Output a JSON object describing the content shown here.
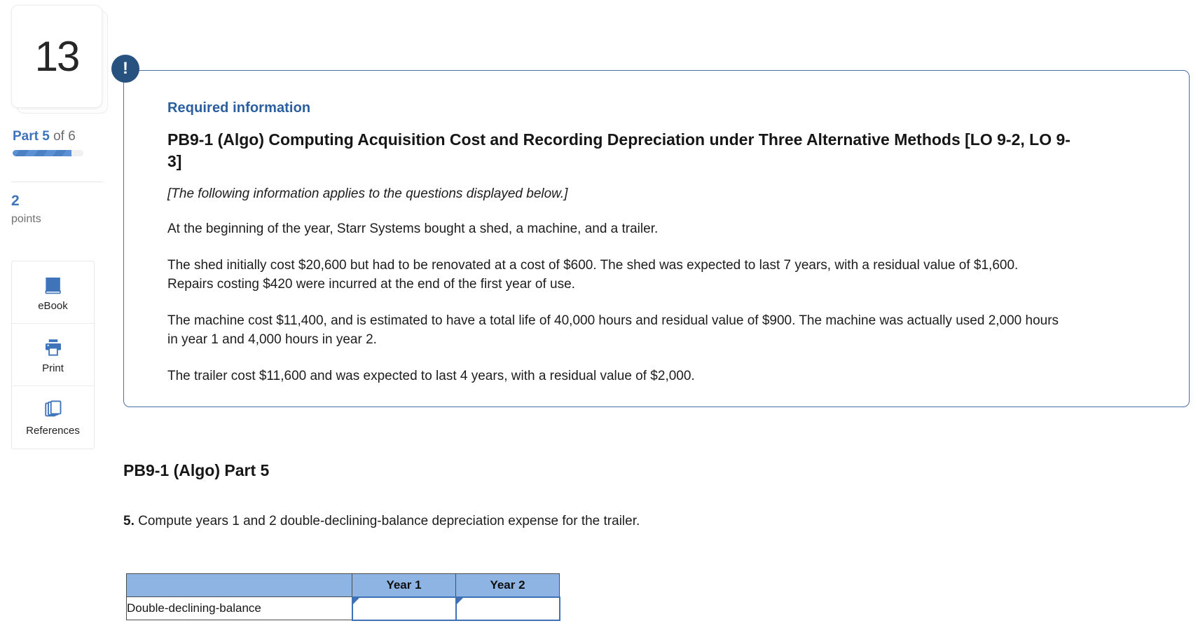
{
  "sidebar": {
    "question_number": "13",
    "part_prefix": "Part",
    "part_current": "5",
    "part_suffix": "of 6",
    "progress_percent": 83,
    "points_value": "2",
    "points_label": "points",
    "tools": [
      {
        "label": "eBook",
        "icon": "ebook-icon"
      },
      {
        "label": "Print",
        "icon": "printer-icon"
      },
      {
        "label": "References",
        "icon": "references-icon"
      }
    ]
  },
  "alert": {
    "icon": "exclamation-icon",
    "icon_glyph": "!",
    "kicker": "Required information",
    "title": "PB9-1 (Algo) Computing Acquisition Cost and Recording Depreciation under Three Alternative Methods [LO 9-2, LO 9-3]",
    "applies_note": "[The following information applies to the questions displayed below.]",
    "paragraphs": [
      "At the beginning of the year, Starr Systems bought a shed, a machine, and a trailer.",
      "The shed initially cost $20,600 but had to be renovated at a cost of $600. The shed was expected to last 7 years, with a residual value of $1,600. Repairs costing $420 were incurred at the end of the first year of use.",
      "The machine cost $11,400, and is estimated to have a total life of 40,000 hours and residual value of $900. The machine was actually used 2,000 hours in year 1 and 4,000 hours in year 2.",
      "The trailer cost $11,600 and was expected to last 4 years, with a residual value of $2,000."
    ]
  },
  "part": {
    "heading": "PB9-1 (Algo) Part 5",
    "question_number": "5.",
    "question_text": "Compute years 1 and 2 double-declining-balance depreciation expense for the trailer."
  },
  "table": {
    "headers": [
      "",
      "Year 1",
      "Year 2"
    ],
    "rows": [
      {
        "label": "Double-declining-balance",
        "year1": "",
        "year2": ""
      }
    ]
  },
  "colors": {
    "accent_blue": "#3f74ba",
    "badge_navy": "#27517f",
    "table_header_blue": "#8db4e2",
    "input_border_blue": "#3e72b5",
    "kicker_blue": "#2b5e9e"
  }
}
